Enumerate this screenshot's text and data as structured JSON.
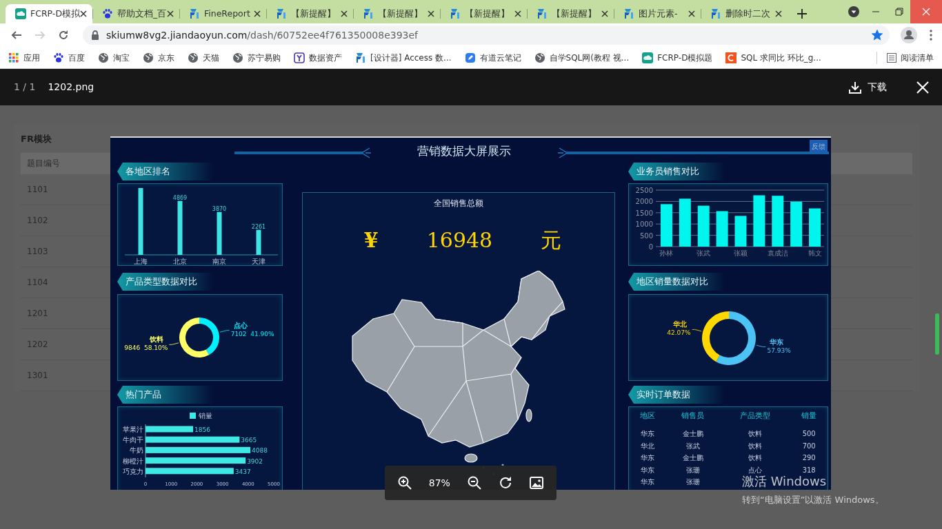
{
  "browser": {
    "tabs": [
      {
        "title": "FCRP-D模拟",
        "kind": "cloud",
        "selected": true
      },
      {
        "title": "帮助文档_百",
        "kind": "paw",
        "selected": false
      },
      {
        "title": "FineReport",
        "kind": "f",
        "selected": false
      },
      {
        "title": "【新提醒】",
        "kind": "f",
        "selected": false
      },
      {
        "title": "【新提醒】",
        "kind": "f",
        "selected": false
      },
      {
        "title": "【新提醒】",
        "kind": "f",
        "selected": false
      },
      {
        "title": "【新提醒】",
        "kind": "f",
        "selected": false
      },
      {
        "title": "图片元素-",
        "kind": "f",
        "selected": false
      },
      {
        "title": "删除时二次",
        "kind": "f",
        "selected": false
      }
    ],
    "nav": [
      {
        "kind": "back",
        "disabled": false
      },
      {
        "kind": "forward",
        "disabled": true
      },
      {
        "kind": "reload",
        "disabled": false
      }
    ],
    "address": {
      "host": "skiumw8vg2.jiandaoyun.com",
      "path": "/dash/60752ee4f761350008e393ef",
      "bookmarked": true
    },
    "bookmarks": [
      {
        "label": "应用",
        "kind": "apps"
      },
      {
        "label": "百度",
        "kind": "paw"
      },
      {
        "label": "淘宝",
        "kind": "globe"
      },
      {
        "label": "京东",
        "kind": "globe"
      },
      {
        "label": "天猫",
        "kind": "globe"
      },
      {
        "label": "苏宁易购",
        "kind": "globe"
      },
      {
        "label": "数据资产",
        "kind": "fork"
      },
      {
        "label": "[设计器] Access 数...",
        "kind": "f"
      },
      {
        "label": "有道云笔记",
        "kind": "note"
      },
      {
        "label": "自学SQL网(教程 视...",
        "kind": "globe"
      },
      {
        "label": "FCRP-D模拟题",
        "kind": "cloud"
      },
      {
        "label": "SQL 求同比 环比_g...",
        "kind": "c"
      }
    ],
    "reading_list": "阅读清单"
  },
  "page": {
    "section": "FR模块",
    "column": "题目编号",
    "rows": [
      "1101",
      "1102",
      "1103",
      "1104",
      "1201",
      "1202",
      "1301"
    ]
  },
  "viewer": {
    "counter": "1 / 1",
    "filename": "1202.png",
    "download": "下载",
    "zoom": "87%"
  },
  "dashboard": {
    "title": "营销数据大屏展示",
    "feedback": "反馈",
    "region_rank": {
      "title": "各地区排名",
      "chart_data": {
        "type": "bar",
        "categories": [
          "上海",
          "北京",
          "南京",
          "天津"
        ],
        "values": [
          6030,
          4869,
          3870,
          2261
        ],
        "value_labels": [
          null,
          "4869",
          "3870",
          "2261"
        ]
      }
    },
    "product_types": {
      "title": "产品类型数据对比",
      "chart_data": {
        "type": "donut",
        "categories": [
          "点心",
          "饮料"
        ],
        "values": [
          7102,
          9846
        ],
        "colors": [
          "#00f0ff",
          "#ffff66"
        ],
        "value_labels": [
          "7102  41.90%",
          "9846  58.10%"
        ]
      }
    },
    "hot_products": {
      "title": "热门产品",
      "chart_data": {
        "type": "bar",
        "orientation": "horizontal",
        "categories": [
          "苹果汁",
          "牛肉干",
          "牛奶",
          "柳橙汁",
          "巧克力"
        ],
        "series": [
          {
            "name": "销量",
            "color": "#3ee8e4",
            "values": [
              1856,
              3665,
              4088,
              3902,
              3437
            ]
          }
        ],
        "xlim": [
          0,
          5000
        ],
        "xticks": [
          0,
          1000,
          2000,
          3000,
          4000,
          5000
        ],
        "data_labels": true
      }
    },
    "total": {
      "title": "全国销售总额",
      "currency": "¥",
      "amount": "16948",
      "unit": "元"
    },
    "sales_people": {
      "title": "业务员销售对比",
      "chart_data": {
        "type": "bar",
        "categories": [
          "孙林",
          null,
          "张武",
          null,
          "张颖",
          null,
          "袁成洁",
          null,
          "韩文"
        ],
        "values": [
          1880,
          2120,
          1810,
          1570,
          1360,
          2270,
          2250,
          1990,
          1690
        ],
        "grid": true,
        "ylim": [
          0,
          2500
        ],
        "yticks": [
          0,
          500,
          1000,
          1500,
          2000,
          2500
        ]
      }
    },
    "region_sales": {
      "title": "地区销量数据对比",
      "chart_data": {
        "type": "donut",
        "categories": [
          "华东",
          "华北"
        ],
        "values": [
          57.93,
          42.07
        ],
        "colors": [
          "#4cc3f5",
          "#ffd800"
        ],
        "value_labels": [
          "57.93%",
          "42.07%"
        ]
      }
    },
    "orders": {
      "title": "实时订单数据",
      "columns": [
        "地区",
        "销售员",
        "产品类型",
        "销量"
      ],
      "rows": [
        [
          "华东",
          "金士鹏",
          "饮料",
          "500"
        ],
        [
          "华北",
          "张武",
          "饮料",
          "700"
        ],
        [
          "华东",
          "金士鹏",
          "饮料",
          "290"
        ],
        [
          "华东",
          "张珊",
          "点心",
          "318"
        ],
        [
          "华东",
          "张珊"
        ]
      ]
    }
  },
  "os_notice": {
    "title": "激活 Windows",
    "hint": "转到“电脑设置”以激活 Windows。"
  }
}
